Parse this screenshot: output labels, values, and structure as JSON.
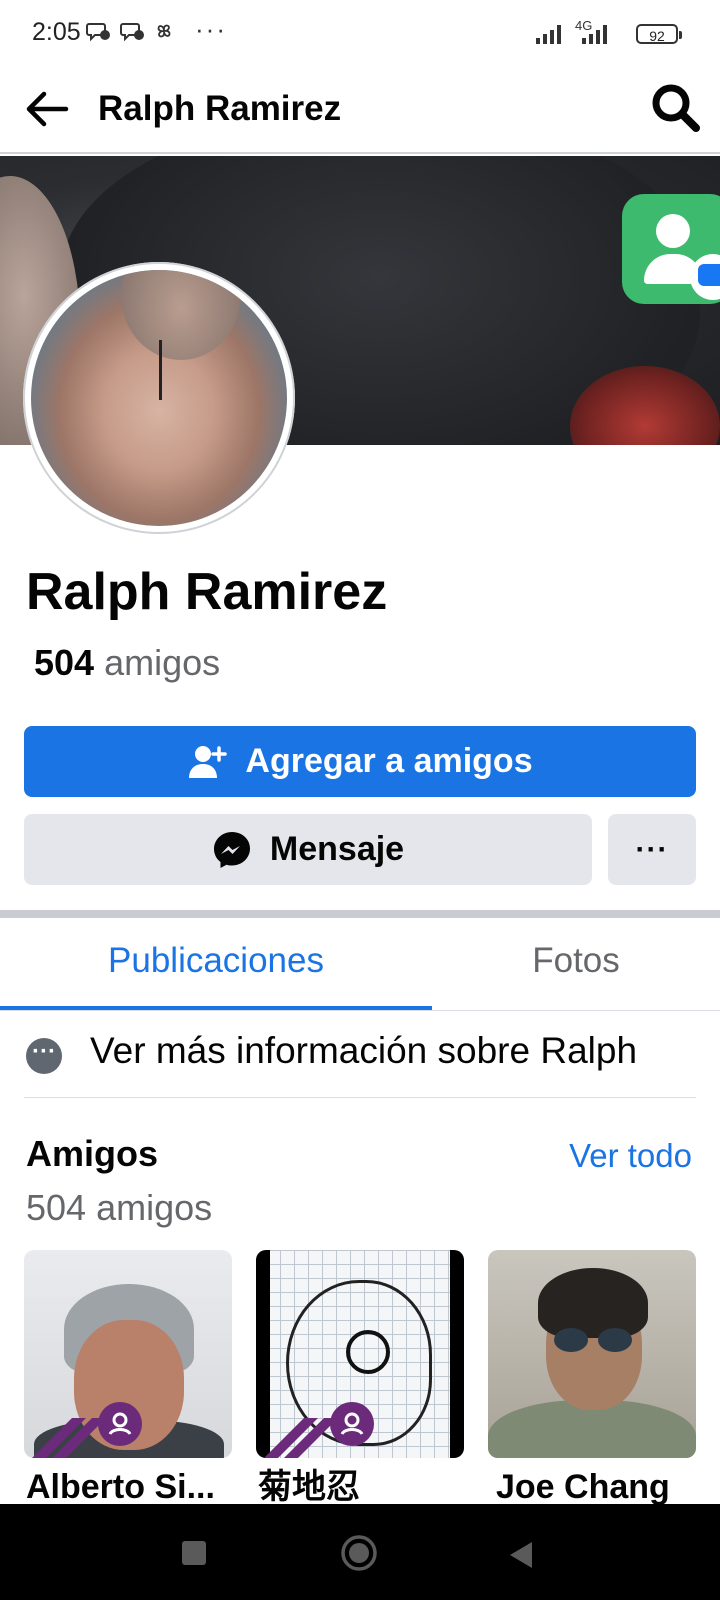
{
  "status_bar": {
    "time": "2:05",
    "more_label": "···",
    "network": "4G",
    "battery": "92"
  },
  "header": {
    "title": "Ralph Ramirez"
  },
  "profile": {
    "name": "Ralph Ramirez",
    "friends_count": "504",
    "friends_word": "amigos"
  },
  "actions": {
    "add_friend_label": "Agregar a amigos",
    "message_label": "Mensaje",
    "more_label": "···"
  },
  "tabs": [
    {
      "label": "Publicaciones",
      "selected": true
    },
    {
      "label": "Fotos",
      "selected": false
    }
  ],
  "info_row": {
    "icon_label": "···",
    "text": "Ver más información sobre Ralph"
  },
  "friends_section": {
    "title": "Amigos",
    "see_all": "Ver todo",
    "subtitle": "504 amigos",
    "items": [
      {
        "name": "Alberto Si..."
      },
      {
        "name": "菊地忍"
      },
      {
        "name": "Joe Chang"
      }
    ]
  },
  "colors": {
    "primary": "#1b74e4",
    "secondary_button": "#e4e6eb",
    "text_secondary": "#65676b"
  }
}
